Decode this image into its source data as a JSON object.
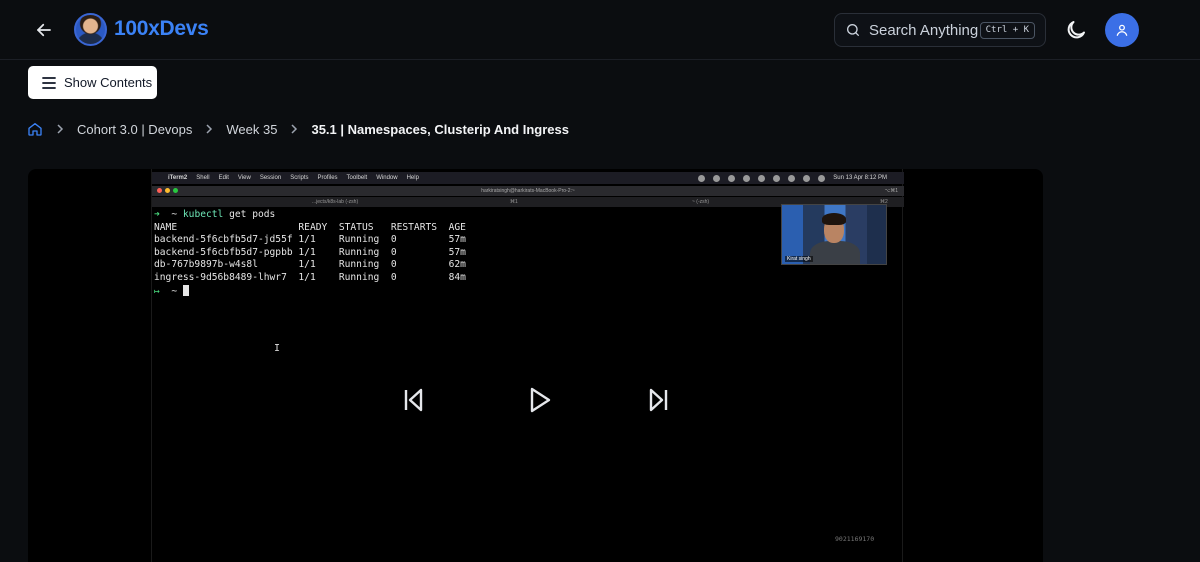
{
  "header": {
    "back_icon": "arrow-left-icon",
    "brand": "100xDevs",
    "search_placeholder": "Search Anything",
    "search_shortcut": "Ctrl + K",
    "theme_icon": "moon-icon",
    "user_icon": "user-icon"
  },
  "sidebar_toggle": {
    "label": "Show Contents",
    "icon": "menu-icon"
  },
  "breadcrumb": {
    "home_icon": "home-icon",
    "items": [
      "Cohort 3.0 | Devops",
      "Week 35"
    ],
    "current": "35.1 | Namespaces, Clusterip And Ingress"
  },
  "video": {
    "menubar": {
      "apple": "",
      "app": "iTerm2",
      "items": [
        "Shell",
        "Edit",
        "View",
        "Session",
        "Scripts",
        "Profiles",
        "Toolbelt",
        "Window",
        "Help"
      ],
      "clock": "Sun 13 Apr  8:12 PM"
    },
    "window_title": "harkiratsingh@harkirats-MacBook-Pro-2:~",
    "window_shortcut": "⌥⌘1",
    "tabs": [
      {
        "label": "...jects/k8s-lab (-zsh)",
        "shortcut": "⌘1"
      },
      {
        "label": "~ (-zsh)",
        "shortcut": "⌘2"
      }
    ],
    "terminal": {
      "prompt_symbol": "➜",
      "cwd": "~",
      "command_bin": "kubectl",
      "command_args": "get pods",
      "headers": [
        "NAME",
        "READY",
        "STATUS",
        "RESTARTS",
        "AGE"
      ],
      "rows": [
        [
          "backend-5f6cbfb5d7-jd55f",
          "1/1",
          "Running",
          "0",
          "57m"
        ],
        [
          "backend-5f6cbfb5d7-pgpbb",
          "1/1",
          "Running",
          "0",
          "57m"
        ],
        [
          "db-767b9897b-w4s8l",
          "1/1",
          "Running",
          "0",
          "62m"
        ],
        [
          "ingress-9d56b8489-lhwr7",
          "1/1",
          "Running",
          "0",
          "84m"
        ]
      ],
      "next_prompt_symbol": "↦",
      "next_cwd": "~"
    },
    "webcam_label": "Kirat singh",
    "controls": {
      "prev_icon": "skip-back-icon",
      "play_icon": "play-icon",
      "next_icon": "skip-forward-icon"
    },
    "watermark": "9021169170"
  },
  "colors": {
    "page_bg": "#0b0d10",
    "brand": "#3b82f6",
    "user_avatar": "#3b6fe6",
    "terminal_prompt": "#4ade80"
  }
}
